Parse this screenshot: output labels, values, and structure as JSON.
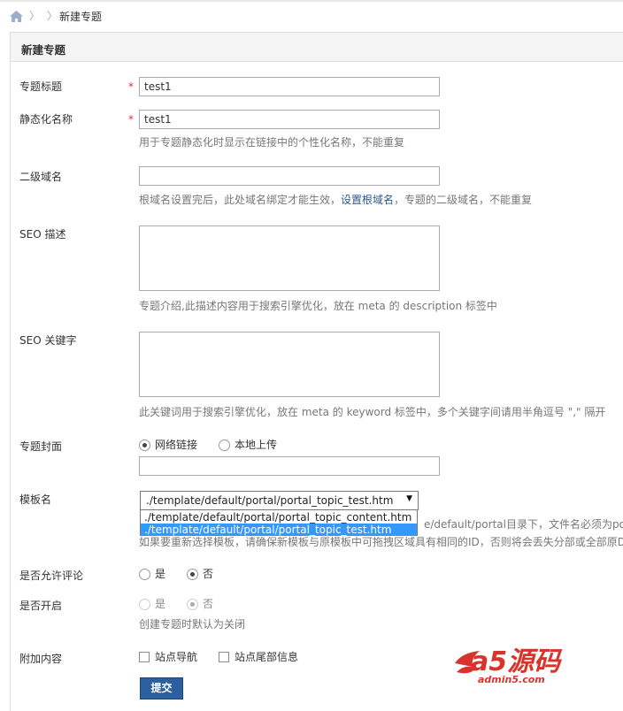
{
  "breadcrumb": {
    "current": "新建专题",
    "separator": "〉"
  },
  "panel": {
    "title": "新建专题"
  },
  "fields": {
    "title": {
      "label": "专题标题",
      "required": "*",
      "value": "test1"
    },
    "static_name": {
      "label": "静态化名称",
      "required": "*",
      "value": "test1",
      "hint": "用于专题静态化时显示在链接中的个性化名称，不能重复"
    },
    "domain": {
      "label": "二级域名",
      "value": "",
      "hint_before": "根域名设置完后，此处域名绑定才能生效，",
      "hint_link": "设置根域名",
      "hint_after": "，专题的二级域名，不能重复"
    },
    "seo_desc": {
      "label": "SEO 描述",
      "hint": "专题介绍,此描述内容用于搜索引擎优化，放在 meta 的 description 标签中"
    },
    "seo_keywords": {
      "label": "SEO 关键字",
      "hint": "此关键词用于搜索引擎优化，放在 meta 的 keyword 标签中，多个关键字间请用半角逗号 \",\" 隔开"
    },
    "cover": {
      "label": "专题封面",
      "opt_web": "网络链接",
      "opt_local": "本地上传",
      "value": ""
    },
    "template": {
      "label": "模板名",
      "selected": "./template/default/portal/portal_topic_test.htm",
      "options": [
        "./template/default/portal/portal_topic_content.htm",
        "./template/default/portal/portal_topic_test.htm"
      ],
      "hint1": "e/default/portal目录下，文件名必须为porta",
      "hint2": "如果要重新选择模板，请确保新模板与原模板中可拖拽区域具有相同的ID，否则将会丢失分部或全部原D"
    },
    "allow_comment": {
      "label": "是否允许评论",
      "yes": "是",
      "no": "否"
    },
    "open": {
      "label": "是否开启",
      "yes": "是",
      "no": "否",
      "hint": "创建专题时默认为关闭"
    },
    "extra": {
      "label": "附加内容",
      "opt_nav": "站点导航",
      "opt_footer": "站点尾部信息"
    }
  },
  "submit_label": "提交",
  "watermark": {
    "brand": "a5源码",
    "url": "admin5.com"
  },
  "colors": {
    "accent": "#2c5f9e",
    "required": "#e53333",
    "select_highlight": "#3399ff",
    "link": "#2b5a8a"
  }
}
